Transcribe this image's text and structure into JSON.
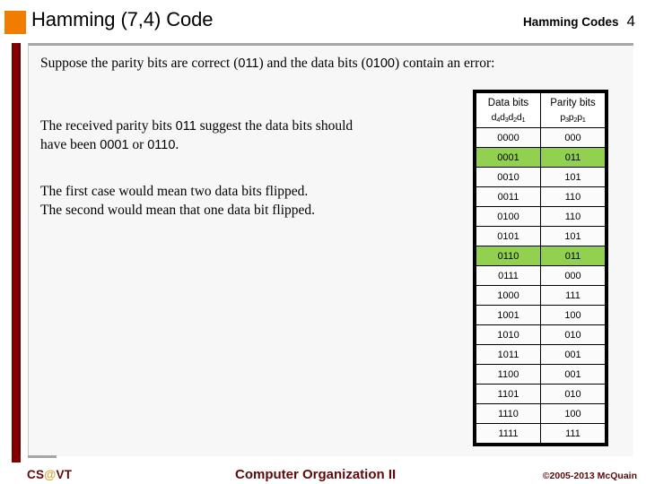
{
  "header": {
    "title": "Hamming (7,4) Code",
    "subject": "Hamming Codes",
    "slide_number": "4",
    "bullet_color": "#F07D00"
  },
  "body": {
    "intro_prefix": "Suppose the parity bits are correct (",
    "intro_parity": "011",
    "intro_middle": ") and the data bits (",
    "intro_data": "0100",
    "intro_suffix": ") contain an error:",
    "received_prefix": "The received parity bits ",
    "received_parity": "011",
    "received_middle": " suggest the data bits should",
    "received_line2_prefix": "have been ",
    "received_option_a": "0001",
    "received_line2_middle": " or ",
    "received_option_b": "0110",
    "received_line2_suffix": ".",
    "case_first": "The first case would mean two data bits flipped.",
    "case_second": "The second would mean that one data bit flipped."
  },
  "table": {
    "headers": [
      {
        "label": "Data bits",
        "sub_prefix": "d",
        "sub": "d4d3d2d1"
      },
      {
        "label": "Parity bits",
        "sub_prefix": "p",
        "sub": "p3p2p1"
      }
    ],
    "highlight_color": "#92D050",
    "rows": [
      {
        "data": "0000",
        "parity": "000",
        "highlight": false
      },
      {
        "data": "0001",
        "parity": "011",
        "highlight": true
      },
      {
        "data": "0010",
        "parity": "101",
        "highlight": false
      },
      {
        "data": "0011",
        "parity": "110",
        "highlight": false
      },
      {
        "data": "0100",
        "parity": "110",
        "highlight": false
      },
      {
        "data": "0101",
        "parity": "101",
        "highlight": false
      },
      {
        "data": "0110",
        "parity": "011",
        "highlight": true
      },
      {
        "data": "0111",
        "parity": "000",
        "highlight": false
      },
      {
        "data": "1000",
        "parity": "111",
        "highlight": false
      },
      {
        "data": "1001",
        "parity": "100",
        "highlight": false
      },
      {
        "data": "1010",
        "parity": "010",
        "highlight": false
      },
      {
        "data": "1011",
        "parity": "001",
        "highlight": false
      },
      {
        "data": "1100",
        "parity": "001",
        "highlight": false
      },
      {
        "data": "1101",
        "parity": "010",
        "highlight": false
      },
      {
        "data": "1110",
        "parity": "100",
        "highlight": false
      },
      {
        "data": "1111",
        "parity": "111",
        "highlight": false
      }
    ]
  },
  "footer": {
    "course_id_pre": "CS",
    "course_id_at": "@",
    "course_id_post": "VT",
    "course_title": "Computer Organization II",
    "copyright": "©2005-2013 McQuain",
    "accent_color": "#5C0A0A"
  }
}
